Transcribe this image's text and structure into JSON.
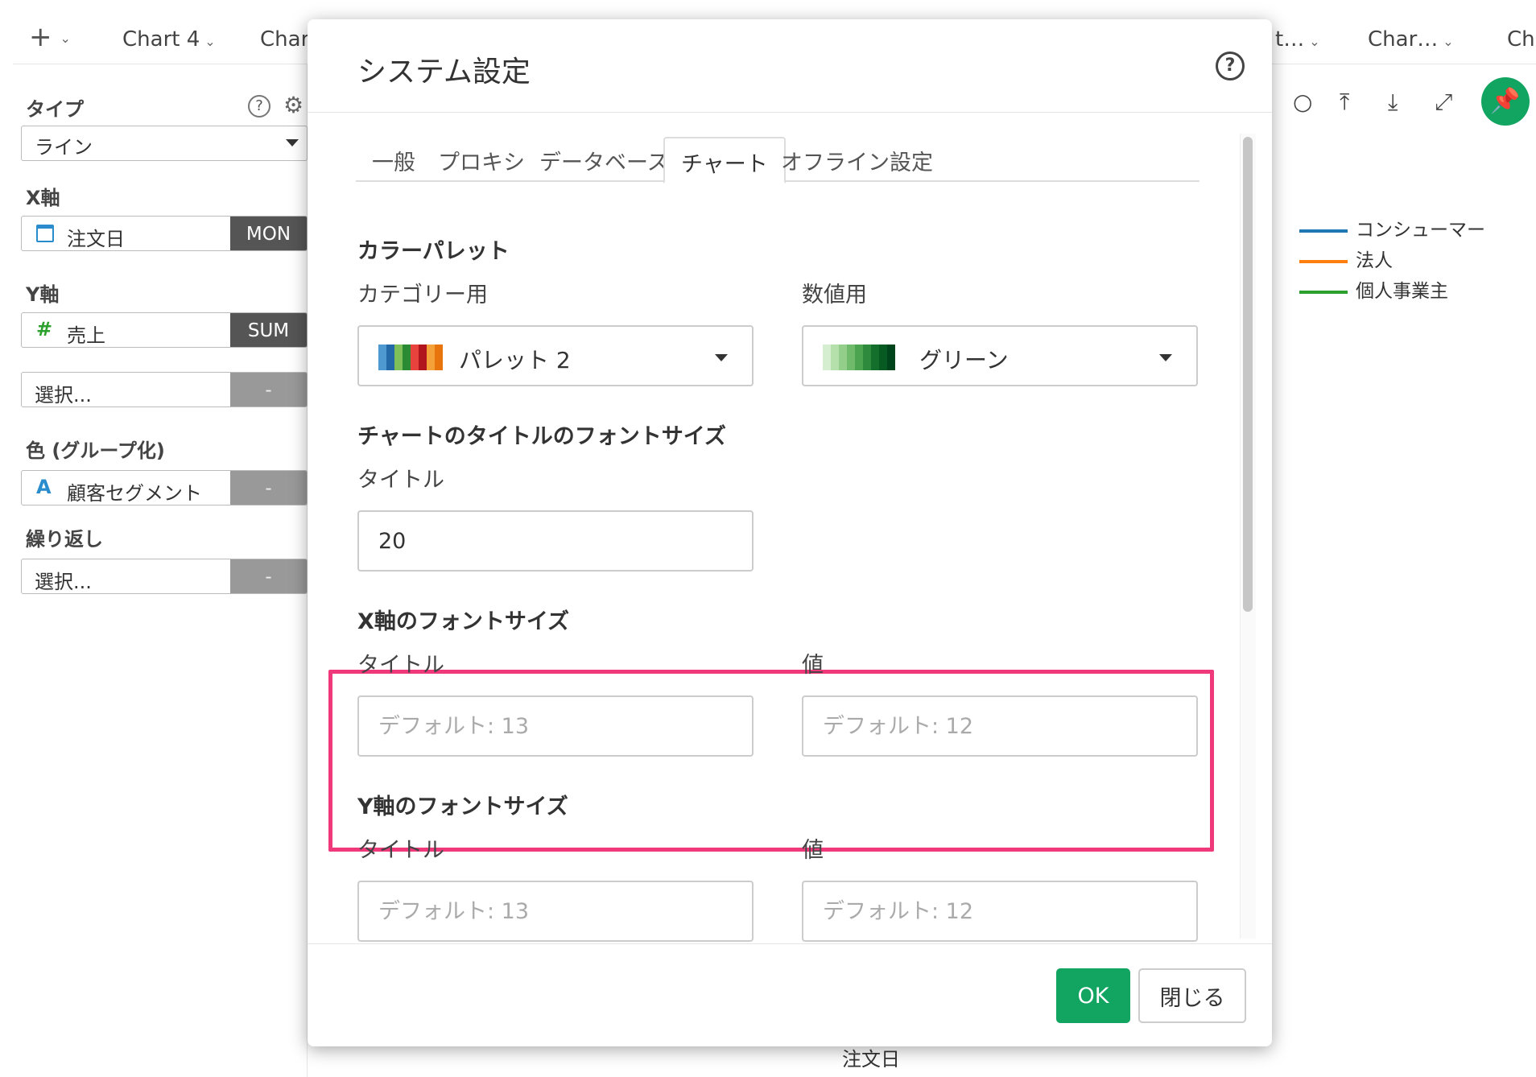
{
  "tabbar": {
    "add_icon": "plus-icon",
    "tabs": [
      "Chart 4",
      "Chart",
      "t…",
      "Char…",
      "Ch"
    ]
  },
  "sidebar": {
    "type_label": "タイプ",
    "type_value": "ライン",
    "x_label": "X軸",
    "x_field": "注文日",
    "x_agg": "MON",
    "y_label": "Y軸",
    "y_field": "売上",
    "y_agg": "SUM",
    "y2_placeholder": "選択...",
    "y2_agg": "-",
    "color_label": "色 (グループ化)",
    "color_field": "顧客セグメント",
    "color_agg": "-",
    "repeat_label": "繰り返し",
    "repeat_placeholder": "選択...",
    "repeat_agg": "-"
  },
  "chart": {
    "legend": [
      {
        "label": "コンシューマー",
        "color": "#1f77b4"
      },
      {
        "label": "法人",
        "color": "#ff7f0e"
      },
      {
        "label": "個人事業主",
        "color": "#2ca02c"
      }
    ],
    "x_axis_title": "注文日"
  },
  "modal": {
    "title": "システム設定",
    "tabs": [
      "一般",
      "プロキシ",
      "データベース",
      "チャート",
      "オフライン設定"
    ],
    "active_tab": "チャート",
    "palette": {
      "section": "カラーパレット",
      "category_label": "カテゴリー用",
      "category_value": "パレット 2",
      "category_colors": [
        "#4e9ad0",
        "#2369a8",
        "#7fbf5a",
        "#2b8a34",
        "#e8433c",
        "#b0141c",
        "#f5a13a",
        "#e8740e"
      ],
      "numeric_label": "数値用",
      "numeric_value": "グリーン",
      "numeric_colors": [
        "#d5eecf",
        "#b5e0ac",
        "#93cf8b",
        "#6fbb6b",
        "#4ca451",
        "#2e8b3d",
        "#156f2c",
        "#075a22",
        "#00441b"
      ]
    },
    "chart_title_font": {
      "section": "チャートのタイトルのフォントサイズ",
      "title_label": "タイトル",
      "title_value": "20"
    },
    "x_axis_font": {
      "section": "X軸のフォントサイズ",
      "title_label": "タイトル",
      "title_placeholder": "デフォルト: 13",
      "value_label": "値",
      "value_placeholder": "デフォルト: 12"
    },
    "y_axis_font": {
      "section": "Y軸のフォントサイズ",
      "title_label": "タイトル",
      "title_placeholder": "デフォルト: 13",
      "value_label": "値",
      "value_placeholder": "デフォルト: 12"
    },
    "ok_label": "OK",
    "close_label": "閉じる"
  }
}
